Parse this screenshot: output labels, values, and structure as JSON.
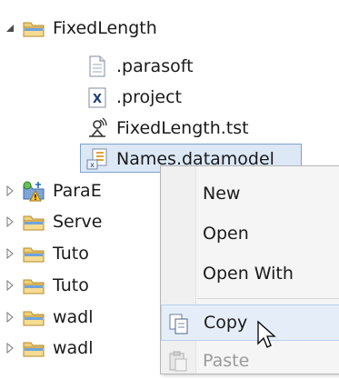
{
  "tree": {
    "root": {
      "label": "FixedLength",
      "icon": "folder-icon",
      "expanded": true
    },
    "children": [
      {
        "label": ".parasoft",
        "icon": "file-icon"
      },
      {
        "label": ".project",
        "icon": "xml-file-icon"
      },
      {
        "label": "FixedLength.tst",
        "icon": "test-suite-icon"
      },
      {
        "label": "Names.datamodel",
        "icon": "datamodel-icon",
        "selected": true
      }
    ],
    "siblings": [
      {
        "label": "ParaE",
        "icon": "project-warning-icon"
      },
      {
        "label": "Serve",
        "icon": "folder-icon"
      },
      {
        "label": "Tuto",
        "icon": "folder-icon"
      },
      {
        "label": "Tuto",
        "icon": "folder-icon"
      },
      {
        "label": "wadl",
        "icon": "folder-icon"
      },
      {
        "label": "wadl",
        "icon": "folder-icon"
      }
    ]
  },
  "context_menu": {
    "items": [
      {
        "label": "New"
      },
      {
        "label": "Open"
      },
      {
        "label": "Open With"
      },
      {
        "label": "Copy",
        "icon": "copy-icon",
        "hovered": true
      },
      {
        "label": "Paste",
        "icon": "paste-icon",
        "disabled": true
      }
    ]
  },
  "colors": {
    "selection_bg": "#dce8f6",
    "selection_border": "#7da2ce",
    "folder": "#e8c36a",
    "menu_bg": "#f5f5f5"
  }
}
